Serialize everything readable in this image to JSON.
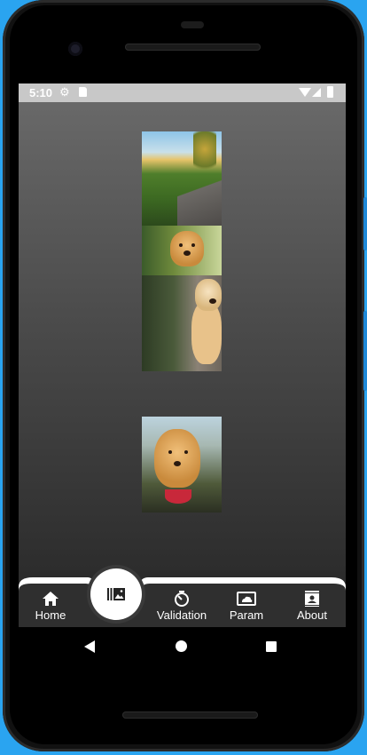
{
  "status_bar": {
    "time": "5:10",
    "icons": [
      "gear-icon",
      "sd-card-icon",
      "wifi-icon",
      "signal-icon",
      "battery-icon"
    ]
  },
  "gallery": {
    "images": [
      {
        "name": "road-landscape-photo"
      },
      {
        "name": "golden-retriever-grass-photo"
      },
      {
        "name": "golden-retriever-path-photo"
      },
      {
        "name": "golden-retriever-car-photo"
      }
    ]
  },
  "bottom_nav": {
    "active_index": 1,
    "items": [
      {
        "label": "Home",
        "icon": "home-icon"
      },
      {
        "label": "",
        "icon": "gallery-icon"
      },
      {
        "label": "Validation",
        "icon": "timer-icon"
      },
      {
        "label": "Param",
        "icon": "cloud-panel-icon"
      },
      {
        "label": "About",
        "icon": "contact-icon"
      }
    ]
  },
  "system_nav": {
    "icons": [
      "back-icon",
      "home-dot-icon",
      "recents-icon"
    ]
  },
  "colors": {
    "frame_accent": "#2aa4f0",
    "screen_top": "#6b6b6b",
    "screen_bottom": "#262626",
    "nav_bar": "#2f2f2f",
    "fab": "#ffffff"
  }
}
